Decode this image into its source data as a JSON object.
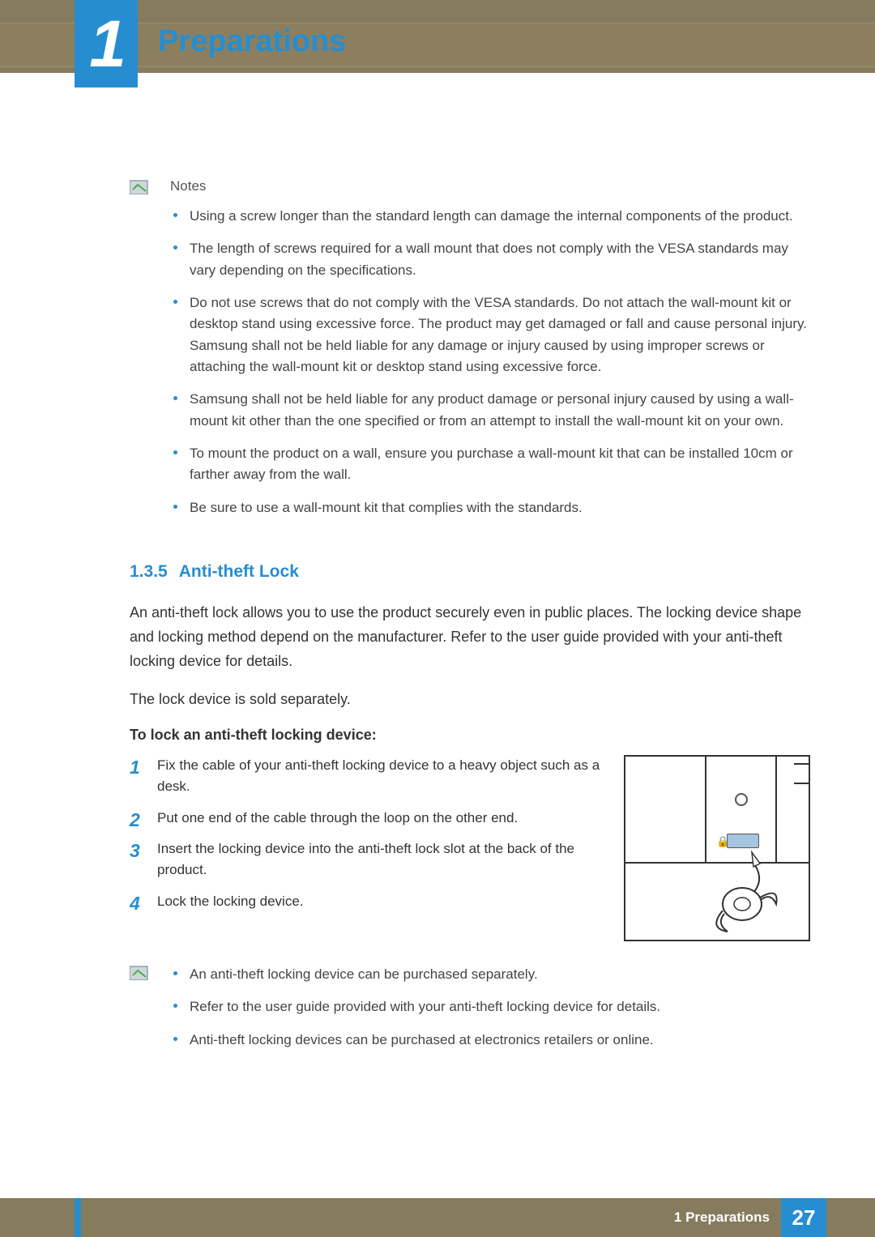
{
  "chapter": {
    "number": "1",
    "title": "Preparations"
  },
  "notes": {
    "label": "Notes",
    "items": [
      "Using a screw longer than the standard length can damage the internal components of the product.",
      "The length of screws required for a wall mount that does not comply with the VESA standards may vary depending on the specifications.",
      "Do not use screws that do not comply with the VESA standards. Do not attach the wall-mount kit or desktop stand using excessive force. The product may get damaged or fall and cause personal injury. Samsung shall not be held liable for any damage or injury caused by using improper screws or attaching the wall-mount kit or desktop stand using excessive force.",
      "Samsung shall not be held liable for any product damage or personal injury caused by using a wall-mount kit other than the one specified or from an attempt to install the wall-mount kit on your own.",
      "To mount the product on a wall, ensure you purchase a wall-mount kit that can be installed 10cm or farther away from the wall.",
      "Be sure to use a wall-mount kit that complies with the standards."
    ]
  },
  "section": {
    "number": "1.3.5",
    "title": "Anti-theft Lock",
    "para1": "An anti-theft lock allows you to use the product securely even in public places. The locking device shape and locking method depend on the manufacturer. Refer to the user guide provided with your anti-theft locking device for details.",
    "para2": "The lock device is sold separately.",
    "steps_heading": "To lock an anti-theft locking device:",
    "steps": [
      "Fix the cable of your anti-theft locking device to a heavy object such as a desk.",
      "Put one end of the cable through the loop on the other end.",
      "Insert the locking device into the anti-theft lock slot at the back of the product.",
      "Lock the locking device."
    ],
    "notes2": [
      "An anti-theft locking device can be purchased separately.",
      "Refer to the user guide provided with your anti-theft locking device for details.",
      "Anti-theft locking devices can be purchased at electronics retailers or online."
    ]
  },
  "footer": {
    "label": "1 Preparations",
    "page": "27"
  }
}
